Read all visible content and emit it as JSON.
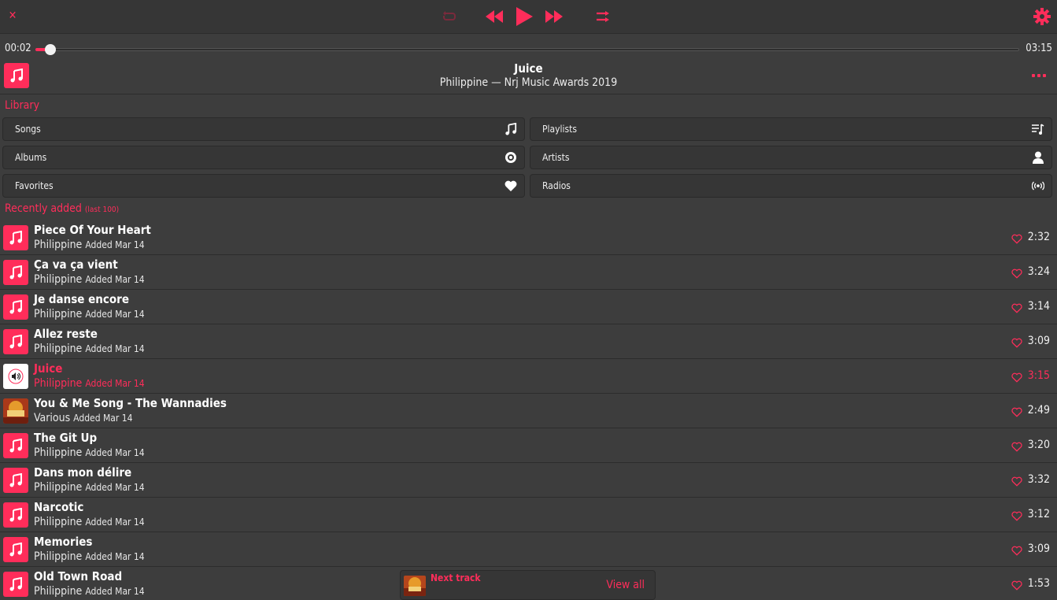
{
  "accent_color": "#ff2d5a",
  "topbar": {
    "close_icon": "close-icon",
    "repeat_icon": "repeat-icon",
    "rewind_icon": "rewind-icon",
    "play_icon": "play-icon",
    "forward_icon": "fast-forward-icon",
    "shuffle_icon": "shuffle-icon",
    "settings_icon": "gear-icon"
  },
  "progress": {
    "elapsed": "00:02",
    "total": "03:15",
    "fraction": 0.013
  },
  "now_playing": {
    "title": "Juice",
    "subtitle": "Philippine — Nrj Music Awards 2019",
    "more_icon": "more-dots-icon"
  },
  "library": {
    "heading": "Library",
    "items": [
      {
        "label": "Songs",
        "icon": "music-note-icon"
      },
      {
        "label": "Playlists",
        "icon": "playlist-icon"
      },
      {
        "label": "Albums",
        "icon": "disc-icon"
      },
      {
        "label": "Artists",
        "icon": "person-icon"
      },
      {
        "label": "Favorites",
        "icon": "heart-icon"
      },
      {
        "label": "Radios",
        "icon": "radio-icon"
      }
    ]
  },
  "recent": {
    "heading": "Recently added",
    "heading_note": "(last 100)",
    "songs": [
      {
        "title": "Piece Of Your Heart",
        "artist": "Philippine",
        "added": "Added Mar 14",
        "duration": "2:32"
      },
      {
        "title": "Ça va ça vient",
        "artist": "Philippine",
        "added": "Added Mar 14",
        "duration": "3:24"
      },
      {
        "title": "Je danse encore",
        "artist": "Philippine",
        "added": "Added Mar 14",
        "duration": "3:14"
      },
      {
        "title": "Allez reste",
        "artist": "Philippine",
        "added": "Added Mar 14",
        "duration": "3:09"
      },
      {
        "title": "Juice",
        "artist": "Philippine",
        "added": "Added Mar 14",
        "duration": "3:15",
        "playing": true
      },
      {
        "title": "You & Me Song - The Wannadies",
        "artist": "Various",
        "added": "Added Mar 14",
        "duration": "2:49",
        "has_cover": true
      },
      {
        "title": "The Git Up",
        "artist": "Philippine",
        "added": "Added Mar 14",
        "duration": "3:20"
      },
      {
        "title": "Dans mon délire",
        "artist": "Philippine",
        "added": "Added Mar 14",
        "duration": "3:32"
      },
      {
        "title": "Narcotic",
        "artist": "Philippine",
        "added": "Added Mar 14",
        "duration": "3:12"
      },
      {
        "title": "Memories",
        "artist": "Philippine",
        "added": "Added Mar 14",
        "duration": "3:09"
      },
      {
        "title": "Old Town Road",
        "artist": "Philippine",
        "added": "Added Mar 14",
        "duration": "1:53"
      }
    ]
  },
  "next_track": {
    "label": "Next track",
    "view_all": "View all"
  }
}
